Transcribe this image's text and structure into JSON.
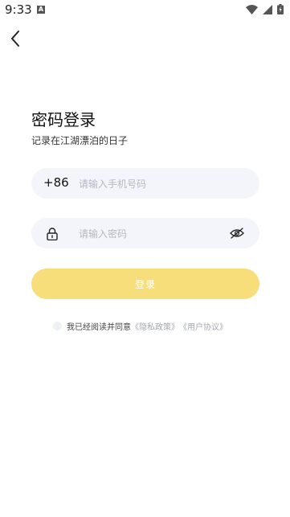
{
  "status_bar": {
    "time": "9:33",
    "notification_icon": "a-icon",
    "icons": [
      "wifi-icon",
      "signal-icon",
      "battery-icon"
    ]
  },
  "header": {
    "back_icon": "chevron-left-icon"
  },
  "login": {
    "title": "密码登录",
    "subtitle": "记录在江湖漂泊的日子",
    "phone": {
      "country_code": "+86",
      "placeholder": "请输入手机号码"
    },
    "password": {
      "placeholder": "请输入密码",
      "lock_icon": "lock-icon",
      "toggle_icon": "eye-off-icon"
    },
    "submit_label": "登录",
    "agreement": {
      "text": "我已经阅读并同意",
      "privacy_link": "《隐私政策》",
      "terms_link": "《用户协议》"
    }
  },
  "colors": {
    "primary_button": "#f8de7a",
    "field_background": "#f4f5fa",
    "link": "#a5a8b0"
  }
}
